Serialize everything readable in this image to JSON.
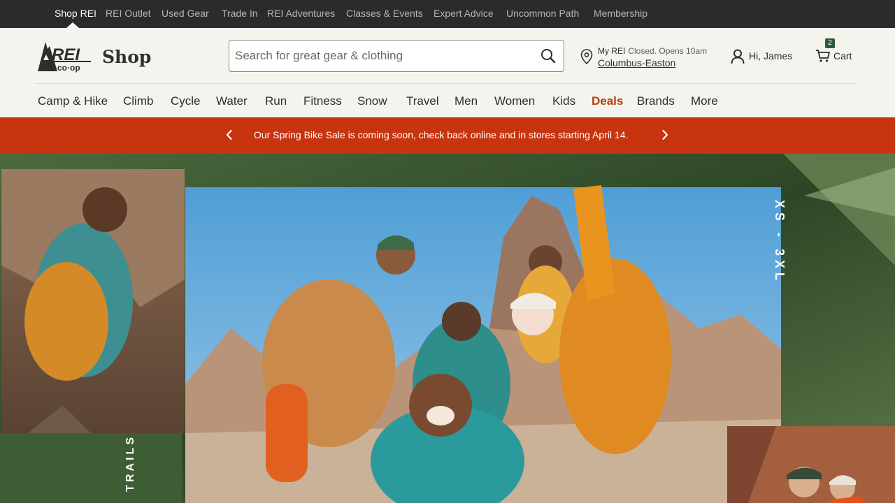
{
  "topbar": {
    "links": [
      {
        "label": "Shop REI"
      },
      {
        "label": "REI Outlet"
      },
      {
        "label": "Used Gear"
      },
      {
        "label": "Trade In"
      },
      {
        "label": "REI Adventures"
      },
      {
        "label": "Classes & Events"
      },
      {
        "label": "Expert Advice"
      },
      {
        "label": "Uncommon Path"
      },
      {
        "label": "Membership"
      }
    ]
  },
  "header": {
    "shop_title": "Shop",
    "search": {
      "placeholder": "Search for great gear & clothing",
      "value": ""
    },
    "store": {
      "prefix": "My REI",
      "status": "Closed. Opens 10am",
      "name": "Columbus-Easton"
    },
    "account": {
      "label": "Hi, James"
    },
    "cart": {
      "label": "Cart",
      "count": "2"
    }
  },
  "categories": [
    {
      "label": "Camp & Hike"
    },
    {
      "label": "Climb"
    },
    {
      "label": "Cycle"
    },
    {
      "label": "Water"
    },
    {
      "label": "Run"
    },
    {
      "label": "Fitness"
    },
    {
      "label": "Snow"
    },
    {
      "label": "Travel"
    },
    {
      "label": "Men"
    },
    {
      "label": "Women"
    },
    {
      "label": "Kids"
    },
    {
      "label": "Deals"
    },
    {
      "label": "Brands"
    },
    {
      "label": "More"
    }
  ],
  "promo": {
    "message": "Our Spring Bike Sale is coming soon, check back online and in stores starting April 14."
  },
  "hero": {
    "size_text": "XS - 3XL",
    "side_text": "TRAILS"
  },
  "colors": {
    "topbar_bg": "#2b2b2b",
    "header_bg": "#f4f3ee",
    "promo_bg": "#c7340f",
    "deals_accent": "#b8400a"
  }
}
